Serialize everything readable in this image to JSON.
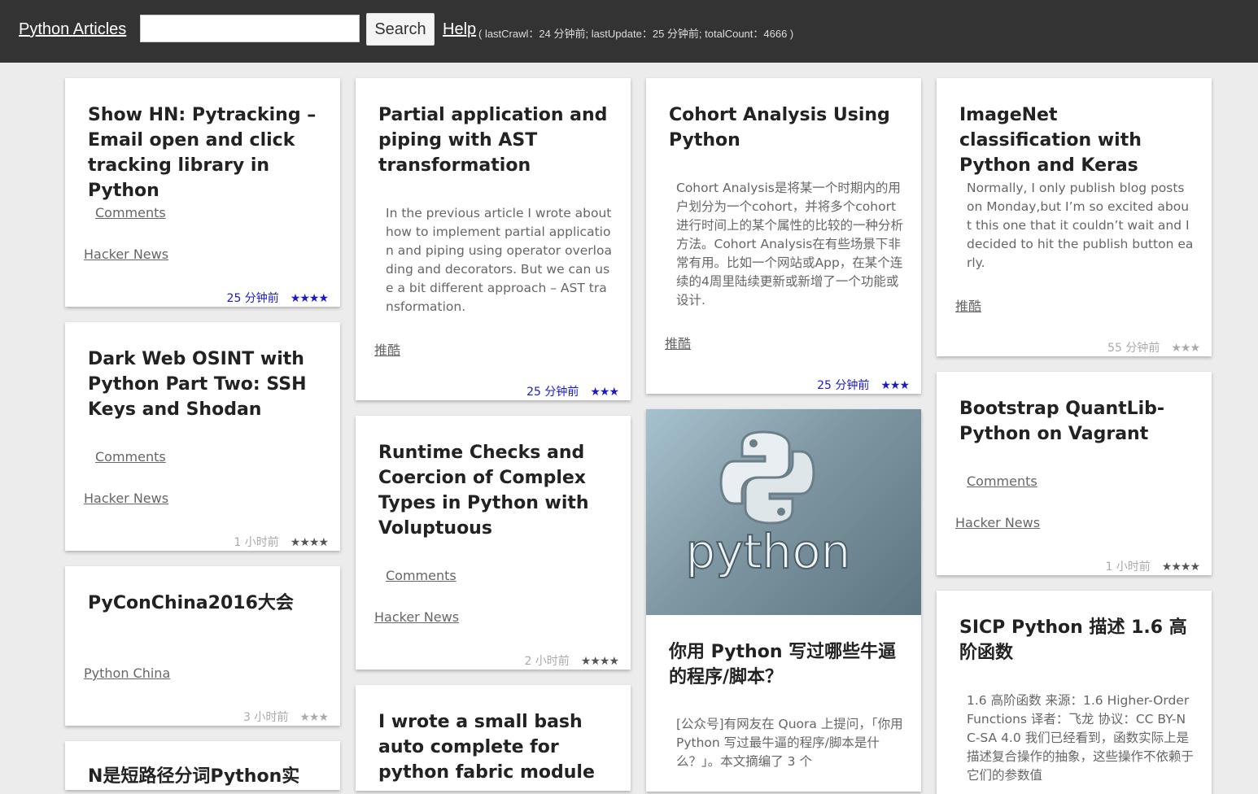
{
  "header": {
    "brand": "Python Articles",
    "search_placeholder": "",
    "search_button": "Search",
    "help": "Help",
    "stats": "( lastCrawl：24 分钟前; lastUpdate：25 分钟前; totalCount：4666 )"
  },
  "cards": [
    {
      "title": "Show HN: Pytracking – Email open and click tracking library in Python",
      "comments": "Comments",
      "source": "Hacker News",
      "time": "25 分钟前",
      "stars": "★★★★"
    },
    {
      "title": "Dark Web OSINT with Python Part Two: SSH Keys and Shodan",
      "comments": "Comments",
      "source": "Hacker News",
      "time": "1 小时前",
      "stars": "★★★★"
    },
    {
      "title": "PyConChina2016大会",
      "source": "Python China",
      "time": "3 小时前",
      "stars": "★★★"
    },
    {
      "title": "N是短路径分词Python实"
    },
    {
      "title": "Partial application and piping with AST transformation",
      "desc": "In the previous article I wrote about how to implement partial application and piping using operator overloading and decorators. But we can use a bit different approach – AST transformation.",
      "source": "推酷",
      "time": "25 分钟前",
      "stars": "★★★"
    },
    {
      "title": "Runtime Checks and Coercion of Complex Types in Python with Voluptuous",
      "comments": "Comments",
      "source": "Hacker News",
      "time": "2 小时前",
      "stars": "★★★★"
    },
    {
      "title": "I wrote a small bash auto complete for python fabric module"
    },
    {
      "title": "Cohort Analysis Using Python",
      "desc": "Cohort Analysis是将某一个时期内的用户划分为一个cohort，并将多个cohort进行时间上的某个属性的比较的一种分析方法。Cohort Analysis在有些场景下非常有用。比如一个网站或App，在某个连续的4周里陆续更新或新增了一个功能或设计.",
      "source": "推酷",
      "time": "25 分钟前",
      "stars": "★★★"
    },
    {
      "image_text": "python",
      "title": "你用 Python 写过哪些牛逼的程序/脚本？",
      "desc": "[公众号]有网友在 Quora 上提问，「你用 Python 写过最牛逼的程序/脚本是什么？」。本文摘编了 3 个"
    },
    {
      "title": "ImageNet classification with Python and Keras",
      "desc": "Normally, I only publish blog posts on Monday,but I’m so excited about this one that it couldn’t wait and I decided to hit the publish button early.",
      "source": "推酷",
      "time": "55 分钟前",
      "stars": "★★★"
    },
    {
      "title": "Bootstrap QuantLib-Python on Vagrant",
      "comments": "Comments",
      "source": "Hacker News",
      "time": "1 小时前",
      "stars": "★★★★"
    },
    {
      "title": "SICP Python 描述 1.6 高阶函数",
      "desc": "1.6 高阶函数 来源：1.6 Higher-Order Functions 译者：飞龙 协议：CC BY-NC-SA 4.0 我们已经看到，函数实际上是描述复合操作的抽象，这些操作不依赖于它们的参数值"
    }
  ]
}
